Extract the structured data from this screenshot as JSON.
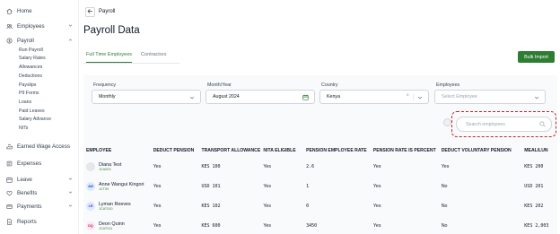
{
  "sidebar": {
    "items": [
      {
        "label": "Home",
        "icon": "home-icon"
      },
      {
        "label": "Employees",
        "icon": "people-icon"
      },
      {
        "label": "Payroll",
        "icon": "payroll-icon"
      },
      {
        "label": "Earned Wage Access",
        "icon": "wage-access-icon"
      },
      {
        "label": "Expenses",
        "icon": "receipt-icon"
      },
      {
        "label": "Leave",
        "icon": "leave-icon"
      },
      {
        "label": "Benefits",
        "icon": "heart-icon"
      },
      {
        "label": "Payments",
        "icon": "card-icon"
      },
      {
        "label": "Reports",
        "icon": "report-icon"
      }
    ],
    "payroll_sub": [
      "Run Payroll",
      "Salary Rates",
      "Allowances",
      "Deductions",
      "Payslips",
      "P9 Forms",
      "Loans",
      "Paid Leaves",
      "Salary Advance",
      "NITs"
    ]
  },
  "header": {
    "breadcrumb": "Payroll",
    "title": "Payroll Data"
  },
  "tabs": [
    {
      "label": "Full Time Employees",
      "active": true
    },
    {
      "label": "Contractors",
      "active": false
    }
  ],
  "bulk_import_label": "Bulk Import",
  "filters": {
    "frequency": {
      "label": "Frequency",
      "value": "Monthly"
    },
    "month_year": {
      "label": "Month/Year",
      "value": "August 2024"
    },
    "country": {
      "label": "Country",
      "value": "Kenya"
    },
    "employees": {
      "label": "Employees",
      "placeholder": "Select Employee"
    }
  },
  "search": {
    "placeholder": "Search employees"
  },
  "table": {
    "columns": [
      "EMPLOYEE",
      "DEDUCT PENSION",
      "TRANSPORT ALLOWANCE",
      "NITA ELIGIBLE",
      "PENSION EMPLOYEE RATE",
      "PENSION RATE IS PERCENT",
      "DEDUCT VOLUNTARY PENSION",
      "MEAL/LUN"
    ],
    "rows": [
      {
        "name": "Diana Test",
        "id": "JCA003",
        "initials": "",
        "avatar_color": "#e5e7eb",
        "initials_color": "#6b7280",
        "cells": [
          "Yes",
          "KES 100",
          "Yes",
          "2.6",
          "Yes",
          "Yes",
          "KES 200"
        ]
      },
      {
        "name": "Anne Wangui Kingori",
        "id": "JCT00",
        "initials": "AW",
        "avatar_color": "#dbeafe",
        "initials_color": "#1d4ed8",
        "cells": [
          "Yes",
          "USD 101",
          "Yes",
          "1",
          "Yes",
          "No",
          "USD 201"
        ]
      },
      {
        "name": "Lyman Reeves",
        "id": "JCAT010",
        "initials": "LR",
        "avatar_color": "#e0e7ff",
        "initials_color": "#4338ca",
        "cells": [
          "Yes",
          "KES 102",
          "Yes",
          "0",
          "Yes",
          "No",
          "KES 202"
        ]
      },
      {
        "name": "Deon Quinn",
        "id": "JCAT011",
        "initials": "DQ",
        "avatar_color": "#fce7f3",
        "initials_color": "#be185d",
        "cells": [
          "Yes",
          "KES 600",
          "Yes",
          "3450",
          "Yes",
          "No",
          "KES 2,003"
        ]
      }
    ]
  },
  "colors": {
    "accent": "#2e7d32",
    "highlight": "#c62828"
  }
}
